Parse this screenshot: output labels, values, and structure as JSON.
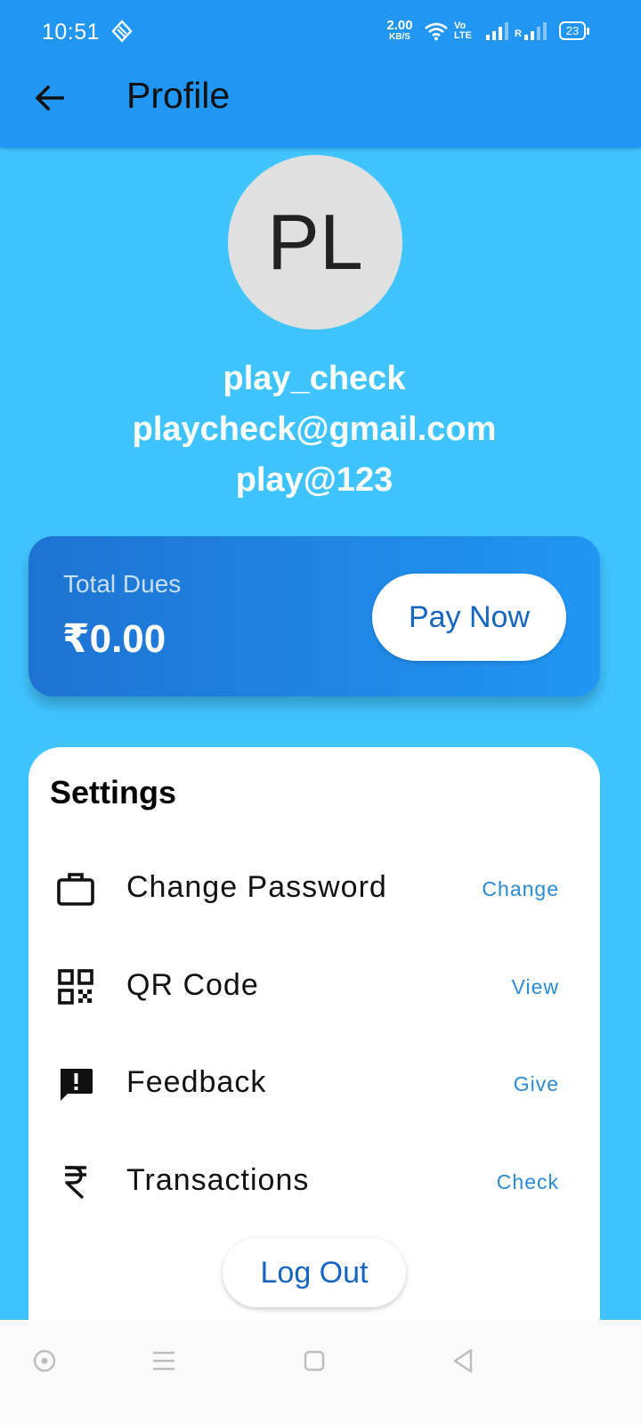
{
  "status_bar": {
    "time": "10:51",
    "net_speed_value": "2.00",
    "net_speed_unit": "KB/S",
    "volte_line1": "Vo",
    "volte_line2": "LTE",
    "roaming": "R",
    "battery": "23"
  },
  "appbar": {
    "title": "Profile",
    "back_icon": "arrow-back-icon",
    "color": "#2196f3"
  },
  "profile": {
    "avatar_initials": "PL",
    "username": "play_check",
    "email": "playcheck@gmail.com",
    "code": "play@123"
  },
  "dues": {
    "label": "Total Dues",
    "amount": "₹0.00",
    "pay_button": "Pay Now"
  },
  "settings": {
    "title": "Settings",
    "items": [
      {
        "icon": "briefcase-icon",
        "label": "Change Password",
        "action": "Change"
      },
      {
        "icon": "qr-code-icon",
        "label": "QR Code",
        "action": "View"
      },
      {
        "icon": "feedback-icon",
        "label": "Feedback",
        "action": "Give"
      },
      {
        "icon": "rupee-icon",
        "label": "Transactions",
        "action": "Check"
      }
    ],
    "logout": "Log Out"
  },
  "colors": {
    "background": "#40c4ff",
    "accent": "#2196f3",
    "link": "#2a8ad6"
  }
}
